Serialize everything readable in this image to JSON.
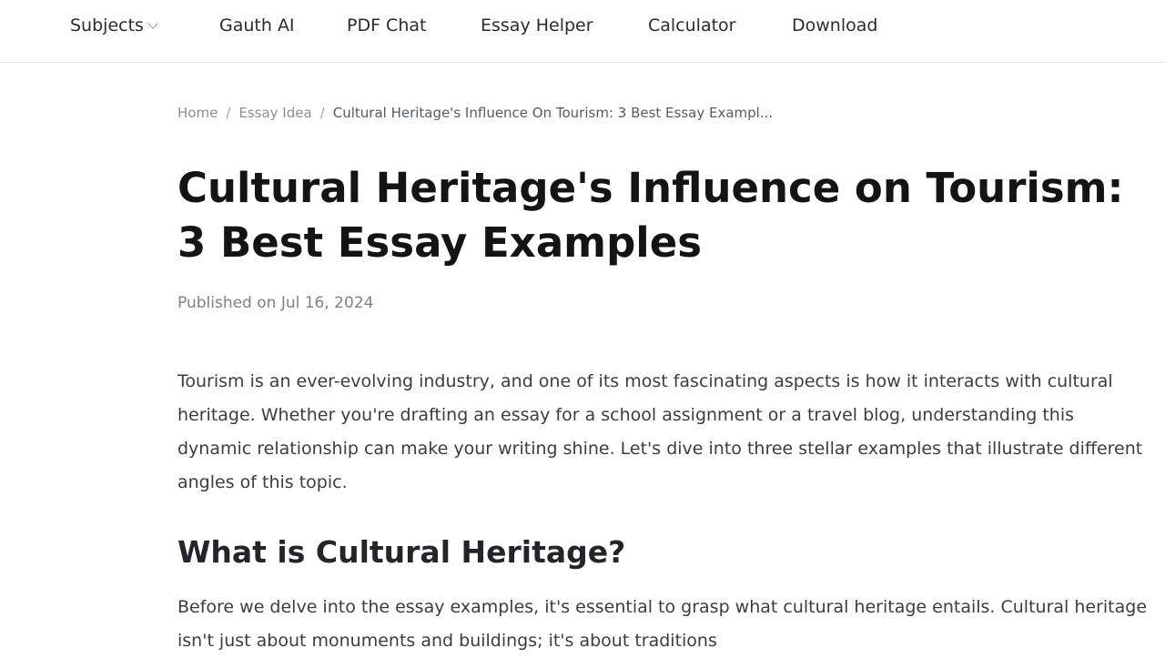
{
  "nav": {
    "items": [
      {
        "label": "Subjects",
        "has_dropdown": true
      },
      {
        "label": "Gauth AI"
      },
      {
        "label": "PDF Chat"
      },
      {
        "label": "Essay Helper"
      },
      {
        "label": "Calculator"
      },
      {
        "label": "Download"
      }
    ]
  },
  "breadcrumb": {
    "home": "Home",
    "separator": "/",
    "category": "Essay Idea",
    "current": "Cultural Heritage's Influence On Tourism: 3 Best Essay Exampl..."
  },
  "article": {
    "title_line1": "Cultural Heritage's Influence on Tourism:",
    "title_line2": "3 Best Essay Examples",
    "published": "Published on Jul 16, 2024",
    "intro": "Tourism is an ever-evolving industry, and one of its most fascinating aspects is how it interacts with cultural heritage. Whether you're drafting an essay for a school assignment or a travel blog, understanding this dynamic relationship can make your writing shine. Let's dive into three stellar examples that illustrate different angles of this topic.",
    "section_heading": "What is Cultural Heritage?",
    "section_para": "Before we delve into the essay examples, it's essential to grasp what cultural heritage entails. Cultural heritage isn't just about monuments and buildings; it's about traditions"
  },
  "colors": {
    "text_primary": "#141414",
    "text_body": "#3a3d42",
    "text_muted": "#8a8f98",
    "nav_border": "#e6e6e6"
  }
}
